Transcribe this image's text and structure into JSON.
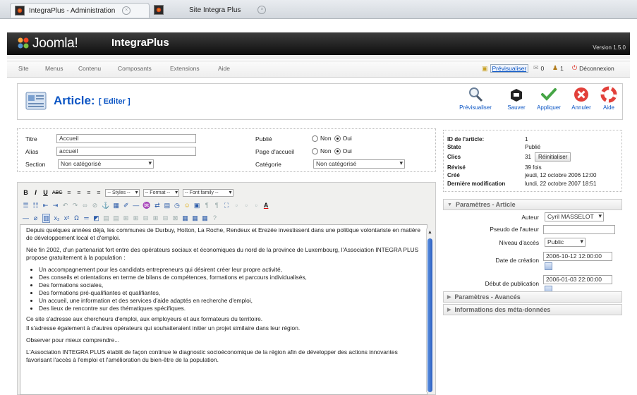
{
  "browser": {
    "tabs": [
      {
        "title": "IntegraPlus - Administration",
        "active": true
      },
      {
        "title": "Site Integra Plus",
        "active": false
      }
    ]
  },
  "header": {
    "brand": "Joomla!",
    "site_name": "IntegraPlus",
    "version": "Version 1.5.0"
  },
  "menu": {
    "items": [
      "Site",
      "Menus",
      "Contenu",
      "Composants",
      "Extensions",
      "Aide"
    ],
    "right": {
      "preview": "Prévisualiser",
      "messages": "0",
      "users": "1",
      "logout": "Déconnexion"
    }
  },
  "toolbar": {
    "title": "Article:",
    "subtitle": "[ Editer ]",
    "buttons": [
      "Prévisualiser",
      "Sauver",
      "Appliquer",
      "Annuler",
      "Aide"
    ]
  },
  "form": {
    "title_label": "Titre",
    "title_value": "Accueil",
    "alias_label": "Alias",
    "alias_value": "accueil",
    "section_label": "Section",
    "section_value": "Non catégorisé",
    "published_label": "Publié",
    "frontpage_label": "Page d'accueil",
    "category_label": "Catégorie",
    "category_value": "Non catégorisé",
    "no": "Non",
    "yes": "Oui"
  },
  "editor": {
    "styles": "-- Styles --",
    "format": "-- Format --",
    "font_family": "-- Font family --",
    "p1": "Depuis quelques années déjà, les communes de Durbuy, Hotton, La Roche, Rendeux et Erezée investissent dans une politique volontariste en matière de développement local et d'emploi.",
    "p2": "Née fin 2002, d'un partenariat fort entre des opérateurs sociaux et économiques du nord de la province de Luxembourg, l'Association INTEGRA PLUS propose gratuitement à la population :",
    "list": [
      "Un accompagnement pour les candidats entrepreneurs qui désirent créer leur propre activité,",
      "Des conseils et orientations en terme de bilans de compétences, formations et parcours individualisés,",
      "Des formations sociales,",
      "Des formations pré-qualifiantes et qualifiantes,",
      "Un accueil, une information et des services d'aide adaptés en recherche d'emploi,",
      "Des lieux de rencontre sur des thématiques spécifiques."
    ],
    "p3a": "Ce site s'adresse aux chercheurs d'emploi, aux employeurs et aux formateurs du territoire.",
    "p3b": "Il s'adresse également à d'autres opérateurs qui souhaiteraient initier un projet similaire dans leur région.",
    "p4": "Observer pour mieux comprendre...",
    "p5": "L'Association INTEGRA PLUS établit de façon continue le diagnostic socioéconomique de la région afin de développer des actions innovantes favorisant l'accès à l'emploi et l'amélioration du bien-être de la population."
  },
  "info": {
    "id_label": "ID de l'article:",
    "id_value": "1",
    "state_label": "State",
    "state_value": "Publié",
    "hits_label": "Clics",
    "hits_value": "31",
    "reset_label": "Réinitialiser",
    "revised_label": "Révisé",
    "revised_value": "39 fois",
    "created_label": "Créé",
    "created_value": "jeudi, 12 octobre 2006 12:00",
    "modified_label": "Dernière modification",
    "modified_value": "lundi, 22 octobre 2007 18:51"
  },
  "params": {
    "article_header": "Paramètres - Article",
    "author_label": "Auteur",
    "author_value": "Cyril MASSELOT",
    "alias_label": "Pseudo de l'auteur",
    "access_label": "Niveau d'accès",
    "access_value": "Public",
    "created_label": "Date de création",
    "created_value": "2006-10-12 12:00:00",
    "publish_up_label": "Début de publication",
    "publish_up_value": "2006-01-03 22:00:00",
    "advanced_header": "Paramètres - Avancés",
    "meta_header": "Informations des méta-données"
  }
}
